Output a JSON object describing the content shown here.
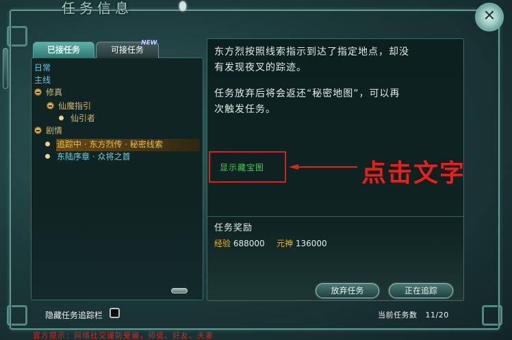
{
  "window": {
    "title": "任务信息",
    "close_symbol": "✕"
  },
  "tabs": {
    "accepted": "已接任务",
    "available": "可接任务",
    "new_badge": "NEW"
  },
  "tree": [
    {
      "label": "日常",
      "kind": "category"
    },
    {
      "label": "主线",
      "kind": "category"
    },
    {
      "label": "修真",
      "kind": "group"
    },
    {
      "label": "仙魔指引",
      "kind": "group"
    },
    {
      "label": "仙引者",
      "kind": "quest"
    },
    {
      "label": "剧情",
      "kind": "group"
    },
    {
      "label": "追踪中 · 东方烈传 · 秘密线索",
      "kind": "tracked-quest"
    },
    {
      "label": "东陆序章 · 众将之首",
      "kind": "quest"
    }
  ],
  "detail": {
    "paragraph1_line1": "东方烈按照线索指示到达了指定地点，却没",
    "paragraph1_line2": "有发现夜叉的踪迹。",
    "paragraph2_line1": "任务放弃后将会返还“秘密地图”，可以再",
    "paragraph2_line2": "次触发任务。",
    "link_text": "显示藏宝图"
  },
  "annotation": {
    "text": "点击文字",
    "color": "#e2231c"
  },
  "reward": {
    "title": "任务奖励",
    "exp_label": "经验",
    "exp_value": "688000",
    "spirit_label": "元神",
    "spirit_value": "136000"
  },
  "buttons": {
    "abandon": "放弃任务",
    "tracking": "正在追踪"
  },
  "footer": {
    "hide_tracker": "隐藏任务追踪栏",
    "count_label": "当前任务数",
    "count_value": "11/20",
    "system_tip": "官方提示：网络社交谨防受骗，师徒、好友、夫妻"
  },
  "colors": {
    "accent_teal": "#5eb1a6",
    "highlight_gold": "#f0c040",
    "link_green": "#3cd34a",
    "warning_red": "#d22b1f"
  }
}
